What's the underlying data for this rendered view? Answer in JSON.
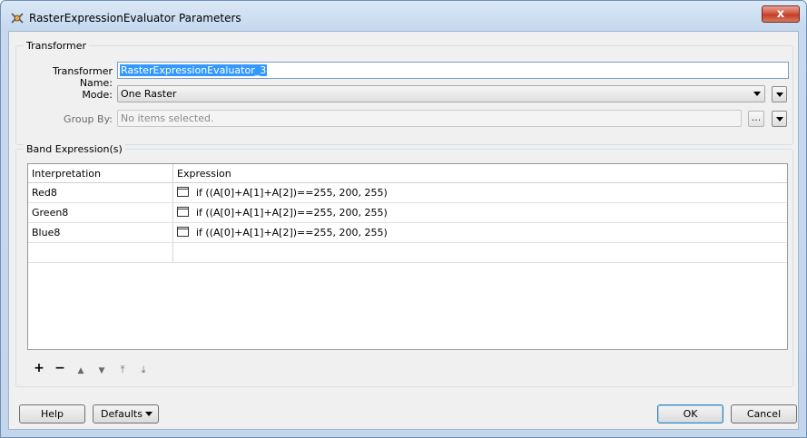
{
  "window": {
    "title": "RasterExpressionEvaluator Parameters",
    "close_label": "x"
  },
  "transformer": {
    "group_label": "Transformer",
    "name_label": "Transformer Name:",
    "name_value": "RasterExpressionEvaluator_3",
    "mode_label": "Mode:",
    "mode_value": "One Raster",
    "group_by_label": "Group By:",
    "group_by_placeholder": "No items selected.",
    "ellipsis_label": "..."
  },
  "bands": {
    "group_label": "Band Expression(s)",
    "columns": [
      "Interpretation",
      "Expression"
    ],
    "rows": [
      {
        "interpretation": "Red8",
        "expression": "if ((A[0]+A[1]+A[2])==255, 200, 255)"
      },
      {
        "interpretation": "Green8",
        "expression": "if ((A[0]+A[1]+A[2])==255, 200, 255)"
      },
      {
        "interpretation": "Blue8",
        "expression": "if ((A[0]+A[1]+A[2])==255, 200, 255)"
      }
    ],
    "toolbar": {
      "add": "+",
      "remove": "−",
      "move_up": "▲",
      "move_down": "▼",
      "move_top": "⤒",
      "move_bottom": "⤓"
    }
  },
  "footer": {
    "help_label": "Help",
    "defaults_label": "Defaults",
    "ok_label": "OK",
    "cancel_label": "Cancel"
  },
  "colors": {
    "selection": "#3399ff",
    "close_button": "#c23a24",
    "title_gradient": "#c6d9ef"
  }
}
